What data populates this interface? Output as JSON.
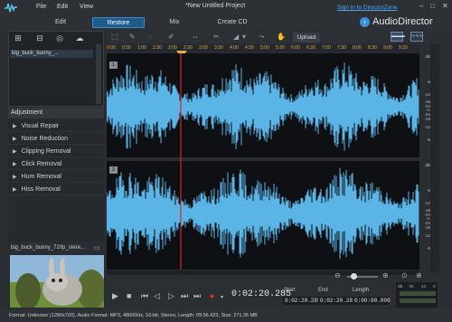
{
  "menu": {
    "file": "File",
    "edit": "Edit",
    "view": "View"
  },
  "window": {
    "title": "*New Untitled Project",
    "sign_in": "Sign in to DirectorZone",
    "brand": "AudioDirector",
    "minimize": "–",
    "maximize": "□",
    "close": "✕"
  },
  "modes": [
    {
      "label": "Edit",
      "active": false
    },
    {
      "label": "Restore",
      "active": true
    },
    {
      "label": "Mix",
      "active": false
    },
    {
      "label": "Create CD",
      "active": false
    }
  ],
  "library": {
    "item": "big_buck_bunny_..."
  },
  "toolbar": {
    "upload": "Upload",
    "view_wave": "▬▬▬",
    "view_spectrum": "∿∿∿"
  },
  "ruler": {
    "ticks": [
      "0:00",
      "0:30",
      "1:00",
      "1:30",
      "2:00",
      "2:30",
      "3:00",
      "3:30",
      "4:00",
      "4:30",
      "5:00",
      "5:30",
      "6:00",
      "6:30",
      "7:00",
      "7:30",
      "8:00",
      "8:30",
      "9:00",
      "9:30"
    ]
  },
  "tracks": [
    {
      "number": "1"
    },
    {
      "number": "2"
    }
  ],
  "db_scale": [
    "dB",
    "-6",
    "-12",
    "-18",
    "-24",
    "-∞",
    "-24",
    "-18",
    "-12",
    "-6"
  ],
  "adjustment": {
    "header": "Adjustment",
    "items": [
      "Visual Repair",
      "Noise Reduction",
      "Clipping Removal",
      "Click Removal",
      "Hum Removal",
      "Hiss Removal"
    ]
  },
  "preview": {
    "label": "big_buck_bunny_720p_stere..."
  },
  "transport": {
    "current_time": "0:02:20.285",
    "start_label": "Start",
    "start": "0:02:20.285",
    "end_label": "End",
    "end": "0:02:20.285",
    "length_label": "Length",
    "length": "0:00:00.000",
    "meter_labels": [
      "dB",
      "-36",
      "-12",
      "0"
    ]
  },
  "status": "Format: Unknown (1280x720), Audio Format: MP3, 48000Hz, 16-bit, Stereo, Length: 09:56.423, Size: 271.26 MB",
  "colors": {
    "accent": "#1f5c8a",
    "waveform": "#5ab4e6",
    "playhead": "#d02828",
    "ruler_text": "#e2a94a"
  }
}
